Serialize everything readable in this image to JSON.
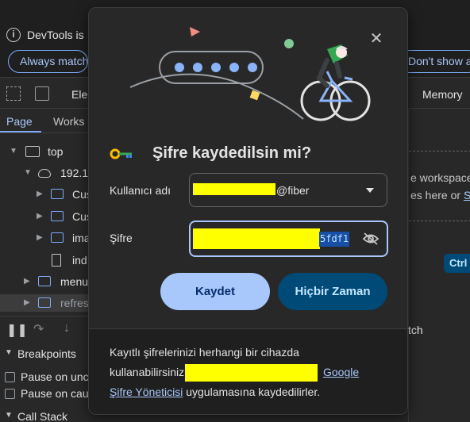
{
  "devtools": {
    "info_text": "DevTools is",
    "always_match_label": "Always match",
    "dont_show_label": "Don't show a",
    "toolbar_elements": "Elem",
    "toolbar_memory": "Memory",
    "tabs": [
      "Page",
      "Works"
    ],
    "tree": {
      "top": "top",
      "host": "192.1",
      "folders": [
        "Cus",
        "Cus",
        "ima"
      ],
      "file": "ind",
      "menu": "menu",
      "refresh": "refres"
    },
    "workspace_line1": "e workspace",
    "workspace_line2": "es here or",
    "workspace_link": "S",
    "ctrl_badge": "Ctrl",
    "breakpoints_label": "Breakpoints",
    "pause_uncaught": "Pause on unc",
    "pause_caught": "Pause on cau",
    "call_stack": "Call Stack",
    "watch_label": "tch"
  },
  "dialog": {
    "title": "Şifre kaydedilsin mi?",
    "username_label": "Kullanıcı adı",
    "username_suffix": "@fiber",
    "password_label": "Şifre",
    "password_tail": "5fdf1",
    "save_button": "Kaydet",
    "never_button": "Hiçbir Zaman",
    "footer_line1": "Kayıtlı şifrelerinizi herhangi bir cihazda",
    "footer_line2_start": "kullanabilirsiniz",
    "footer_google": "Google",
    "footer_manager_link": "Şifre Yöneticisi",
    "footer_line3_rest": " uygulamasına kaydedilirler."
  },
  "colors": {
    "accent": "#a8c7fa",
    "redaction": "#ffff00",
    "tonal_button": "#004a77"
  },
  "icons": [
    "info-icon",
    "close-icon",
    "key-icon",
    "chevron-down-icon",
    "eye-off-icon",
    "folder-icon",
    "file-icon",
    "cloud-icon",
    "frame-icon"
  ]
}
